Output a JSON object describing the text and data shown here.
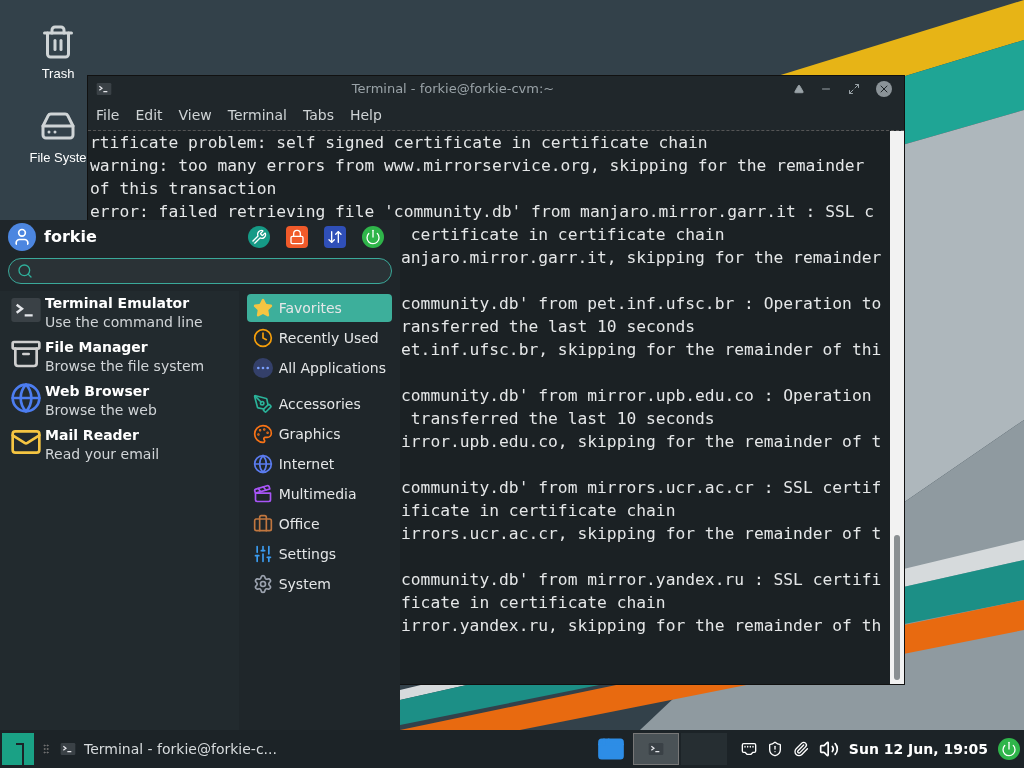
{
  "desktop": {
    "icons": [
      {
        "label": "Trash",
        "kind": "trash"
      },
      {
        "label": "File Syste",
        "kind": "drive"
      }
    ]
  },
  "terminal": {
    "title": "Terminal - forkie@forkie-cvm:~",
    "menu": [
      "File",
      "Edit",
      "View",
      "Terminal",
      "Tabs",
      "Help"
    ],
    "lines": [
      "rtificate problem: self signed certificate in certificate chain",
      "warning: too many errors from www.mirrorservice.org, skipping for the remainder",
      "of this transaction",
      "error: failed retrieving file 'community.db' from manjaro.mirror.garr.it : SSL c"
    ],
    "blocks": [
      [
        " certificate in certificate chain",
        "anjaro.mirror.garr.it, skipping for the remainder"
      ],
      [
        "community.db' from pet.inf.ufsc.br : Operation to",
        "ransferred the last 10 seconds",
        "et.inf.ufsc.br, skipping for the remainder of thi"
      ],
      [
        "community.db' from mirror.upb.edu.co : Operation",
        " transferred the last 10 seconds",
        "irror.upb.edu.co, skipping for the remainder of t"
      ],
      [
        "community.db' from mirrors.ucr.ac.cr : SSL certif",
        "ificate in certificate chain",
        "irrors.ucr.ac.cr, skipping for the remainder of t"
      ],
      [
        "community.db' from mirror.yandex.ru : SSL certifi",
        "ficate in certificate chain",
        "irror.yandex.ru, skipping for the remainder of th"
      ]
    ]
  },
  "menu": {
    "user": "forkie",
    "favorites": [
      {
        "name": "Terminal Emulator",
        "description": "Use the command line",
        "kind": "terminal"
      },
      {
        "name": "File Manager",
        "description": "Browse the file system",
        "kind": "files"
      },
      {
        "name": "Web Browser",
        "description": "Browse the web",
        "kind": "browser"
      },
      {
        "name": "Mail Reader",
        "description": "Read your email",
        "kind": "mail"
      }
    ],
    "category_groups": [
      [
        {
          "label": "Favorites",
          "kind": "favorites",
          "selected": true
        },
        {
          "label": "Recently Used",
          "kind": "recent",
          "selected": false
        },
        {
          "label": "All Applications",
          "kind": "all",
          "selected": false
        }
      ],
      [
        {
          "label": "Accessories",
          "kind": "accessories",
          "selected": false
        },
        {
          "label": "Graphics",
          "kind": "graphics",
          "selected": false
        },
        {
          "label": "Internet",
          "kind": "internet",
          "selected": false
        },
        {
          "label": "Multimedia",
          "kind": "multimedia",
          "selected": false
        },
        {
          "label": "Office",
          "kind": "office",
          "selected": false
        },
        {
          "label": "Settings",
          "kind": "settings",
          "selected": false
        },
        {
          "label": "System",
          "kind": "system",
          "selected": false
        }
      ]
    ]
  },
  "taskbar": {
    "task": "Terminal - forkie@forkie-c...",
    "workspaces": [
      {
        "selected": true
      },
      {
        "selected": false
      }
    ],
    "clock": "Sun 12 Jun, 19:05"
  }
}
